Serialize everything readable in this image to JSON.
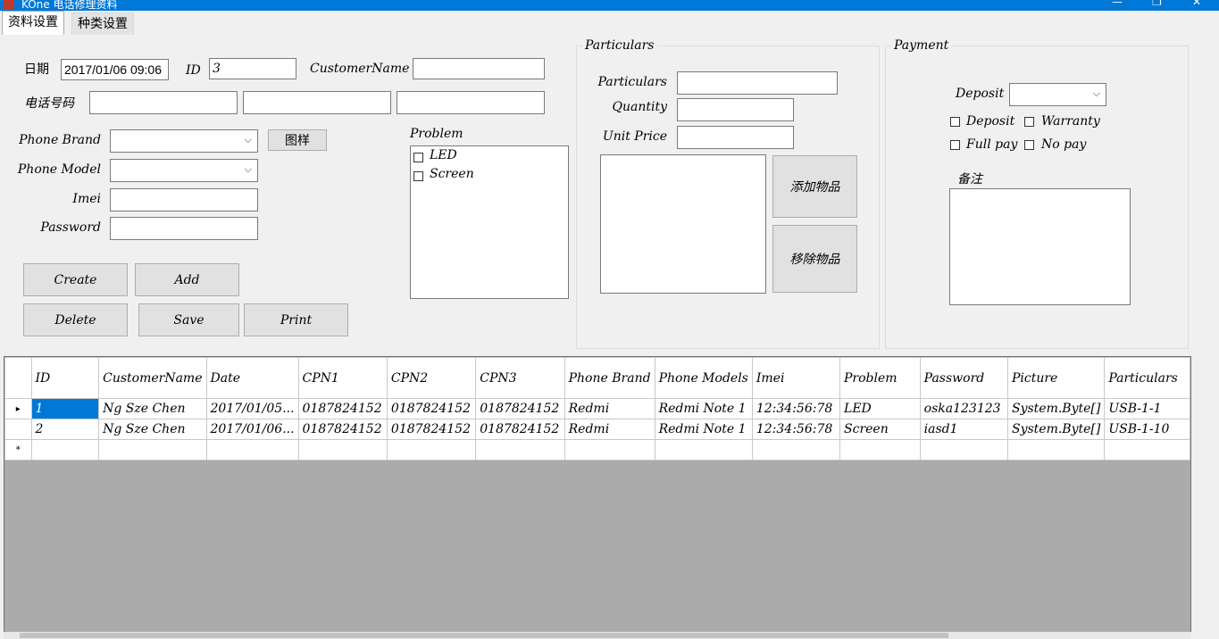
{
  "window": {
    "title": "KOne 电话修理资料"
  },
  "tabs": [
    {
      "label": "资料设置"
    },
    {
      "label": "种类设置"
    }
  ],
  "form": {
    "date_label": "日期",
    "date_value": "2017/01/06 09:06",
    "id_label": "ID",
    "id_value": "3",
    "customer_name_label": "CustomerName",
    "phone_label": "电话号码",
    "phone_brand_label": "Phone Brand",
    "phone_model_label": "Phone Model",
    "imei_label": "Imei",
    "password_label": "Password",
    "sample_button": "图样",
    "buttons": {
      "create": "Create",
      "add": "Add",
      "delete": "Delete",
      "save": "Save",
      "print": "Print"
    }
  },
  "problem": {
    "title": "Problem",
    "items": [
      {
        "label": "LED",
        "checked": false
      },
      {
        "label": "Screen",
        "checked": false
      }
    ]
  },
  "particulars": {
    "group_title": "Particulars",
    "particulars_label": "Particulars",
    "quantity_label": "Quantity",
    "unit_price_label": "Unit Price",
    "add_item_button": "添加物品",
    "remove_item_button": "移除物品"
  },
  "payment": {
    "group_title": "Payment",
    "deposit_label": "Deposit",
    "checkboxes": [
      {
        "label": "Deposit",
        "checked": false
      },
      {
        "label": "Warranty",
        "checked": false
      },
      {
        "label": "Full pay",
        "checked": false
      },
      {
        "label": "No pay",
        "checked": false
      }
    ],
    "remarks_label": "备注"
  },
  "grid": {
    "columns": [
      "ID",
      "CustomerName",
      "Date",
      "CPN1",
      "CPN2",
      "CPN3",
      "Phone Brand",
      "Phone Models",
      "Imei",
      "Problem",
      "Password",
      "Picture",
      "Particulars"
    ],
    "rows": [
      [
        "1",
        "Ng Sze Chen",
        "2017/01/05...",
        "0187824152",
        "0187824152",
        "0187824152",
        "Redmi",
        "Redmi Note 1",
        "12:34:56:78",
        "LED",
        "oska123123",
        "System.Byte[]",
        "USB-1-1"
      ],
      [
        "2",
        "Ng Sze Chen",
        "2017/01/06...",
        "0187824152",
        "0187824152",
        "0187824152",
        "Redmi",
        "Redmi Note 1",
        "12:34:56:78",
        "Screen",
        "iasd1",
        "System.Byte[]",
        "USB-1-10"
      ]
    ],
    "current_row_marker": "▸",
    "new_row_marker": "*"
  },
  "colors": {
    "titlebar": "#0078d7",
    "selection": "#0078d7",
    "grid_background": "#ababab"
  },
  "icons": {
    "dropdown": "chevron-down-icon",
    "row_pointer": "row-pointer-icon"
  }
}
